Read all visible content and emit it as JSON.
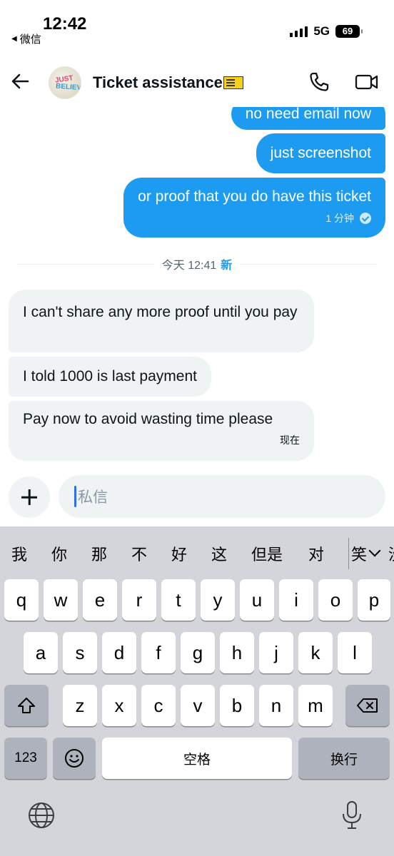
{
  "status_bar": {
    "time": "12:42",
    "back_app": "微信",
    "network": "5G",
    "battery": "69"
  },
  "header": {
    "title": "Ticket assistance",
    "avatar_text_top": "JUST",
    "avatar_text_bottom": "BELIEVE"
  },
  "messages": {
    "outgoing": [
      {
        "text": "no need email now"
      },
      {
        "text": "just screenshot"
      },
      {
        "text": "or proof that you do have this ticket",
        "time": "1 分钟"
      }
    ],
    "divider": {
      "text": "今天 12:41",
      "new_label": "新"
    },
    "incoming": [
      {
        "text": "I can't share any more proof until you pay"
      },
      {
        "text": "I told 1000 is last payment"
      },
      {
        "text": "Pay now to avoid wasting time please",
        "time": "现在"
      }
    ]
  },
  "composer": {
    "placeholder": "私信"
  },
  "keyboard": {
    "candidates": [
      "我",
      "你",
      "那",
      "不",
      "好",
      "这",
      "但是",
      "对",
      "笑",
      "没"
    ],
    "row1": [
      "q",
      "w",
      "e",
      "r",
      "t",
      "y",
      "u",
      "i",
      "o",
      "p"
    ],
    "row2": [
      "a",
      "s",
      "d",
      "f",
      "g",
      "h",
      "j",
      "k",
      "l"
    ],
    "row3": [
      "z",
      "x",
      "c",
      "v",
      "b",
      "n",
      "m"
    ],
    "numbers_key": "123",
    "space_key": "空格",
    "return_key": "换行"
  },
  "colors": {
    "accent": "#1d9bf0",
    "incoming_bubble": "#eff3f4",
    "keyboard_bg": "#d3d5db"
  }
}
